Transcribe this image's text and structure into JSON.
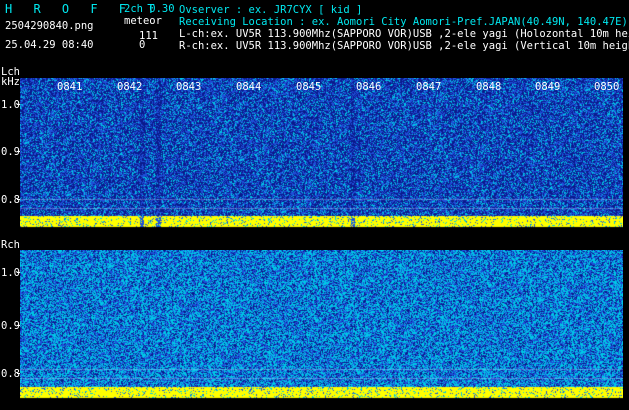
{
  "header": {
    "brand": "H R O F F T",
    "mode": "2ch 0.30",
    "type_label": "meteor",
    "file_name": "2504290840.png",
    "timestamp": "25.04.29 08:40",
    "count_l": "111",
    "count_r": "0",
    "observer": "Ovserver                 : ex. JR7CYX [ kid ]",
    "location": "Receiving Location : ex. Aomori City Aomori-Pref.JAPAN(40.49N, 140.47E)",
    "lch_info": "L-ch:ex. UV5R 113.900Mhz(SAPPORO VOR)USB ,2-ele yagi (Holozontal 10m height)",
    "rch_info": "R-ch:ex. UV5R 113.900Mhz(SAPPORO VOR)USB ,2-ele yagi (Vertical 10m height)"
  },
  "lch": {
    "label": "Lch",
    "unit": "kHz",
    "y_ticks": [
      "1.0",
      "0.9",
      "0.8"
    ],
    "time_labels": [
      "0841",
      "0842",
      "0843",
      "0844",
      "0845",
      "0846",
      "0847",
      "0848",
      "0849",
      "0850"
    ]
  },
  "rch": {
    "label": "Rch",
    "y_ticks": [
      "1.0",
      "0.9",
      "0.8"
    ]
  },
  "colors": {
    "background": "#000000",
    "noise_dark": "#0a1a8c",
    "noise_mid": "#1e4fd8",
    "noise_light": "#00c8e6",
    "signal": "#ffff00",
    "text_cyan": "#00e8f0"
  }
}
